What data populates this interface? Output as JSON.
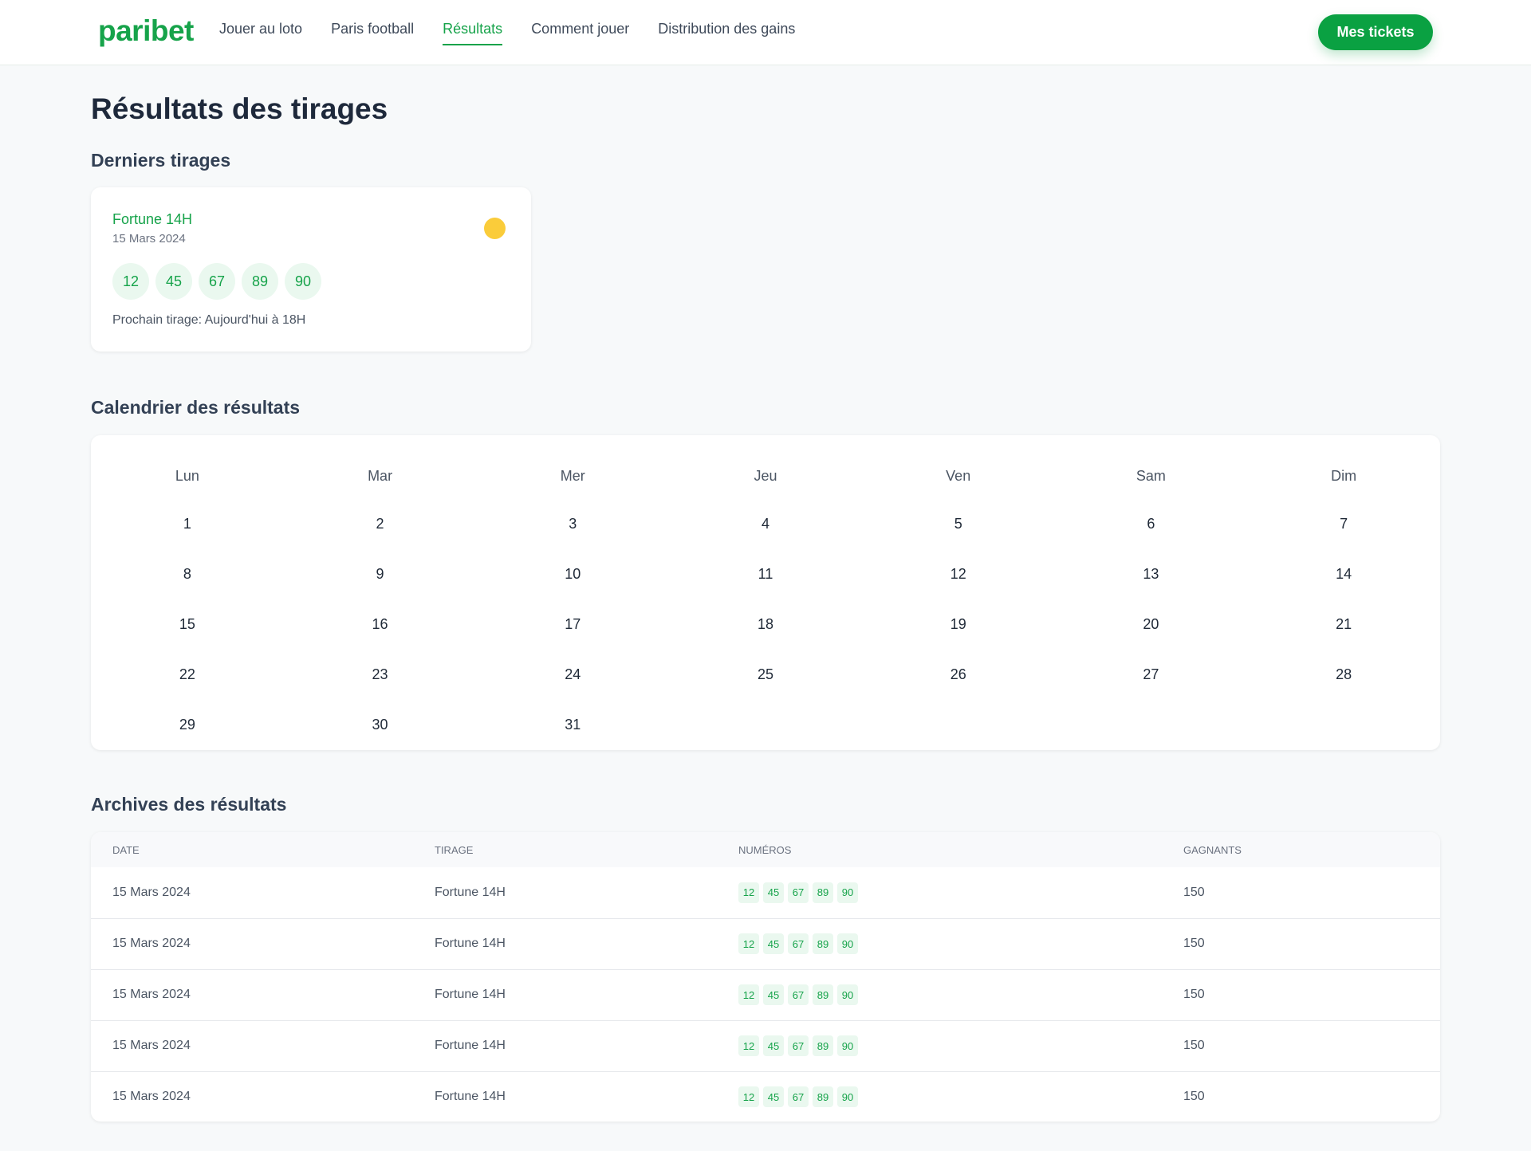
{
  "brand": {
    "logo": "paribet"
  },
  "nav": {
    "items": [
      {
        "label": "Jouer au loto",
        "active": false
      },
      {
        "label": "Paris football",
        "active": false
      },
      {
        "label": "Résultats",
        "active": true
      },
      {
        "label": "Comment jouer",
        "active": false
      },
      {
        "label": "Distribution des gains",
        "active": false
      }
    ],
    "tickets_button": "Mes tickets"
  },
  "page": {
    "title": "Résultats des tirages"
  },
  "latest": {
    "section_title": "Derniers tirages",
    "draw": {
      "name": "Fortune 14H",
      "date": "15 Mars 2024",
      "icon": "sun-icon",
      "numbers": [
        "12",
        "45",
        "67",
        "89",
        "90"
      ],
      "next_draw": "Prochain tirage: Aujourd'hui à 18H"
    }
  },
  "calendar": {
    "section_title": "Calendrier des résultats",
    "weekdays": [
      "Lun",
      "Mar",
      "Mer",
      "Jeu",
      "Ven",
      "Sam",
      "Dim"
    ],
    "days": [
      "1",
      "2",
      "3",
      "4",
      "5",
      "6",
      "7",
      "8",
      "9",
      "10",
      "11",
      "12",
      "13",
      "14",
      "15",
      "16",
      "17",
      "18",
      "19",
      "20",
      "21",
      "22",
      "23",
      "24",
      "25",
      "26",
      "27",
      "28",
      "29",
      "30",
      "31"
    ]
  },
  "archives": {
    "section_title": "Archives des résultats",
    "columns": [
      "DATE",
      "TIRAGE",
      "NUMÉROS",
      "GAGNANTS"
    ],
    "rows": [
      {
        "date": "15 Mars 2024",
        "draw": "Fortune 14H",
        "numbers": [
          "12",
          "45",
          "67",
          "89",
          "90"
        ],
        "winners": "150"
      },
      {
        "date": "15 Mars 2024",
        "draw": "Fortune 14H",
        "numbers": [
          "12",
          "45",
          "67",
          "89",
          "90"
        ],
        "winners": "150"
      },
      {
        "date": "15 Mars 2024",
        "draw": "Fortune 14H",
        "numbers": [
          "12",
          "45",
          "67",
          "89",
          "90"
        ],
        "winners": "150"
      },
      {
        "date": "15 Mars 2024",
        "draw": "Fortune 14H",
        "numbers": [
          "12",
          "45",
          "67",
          "89",
          "90"
        ],
        "winners": "150"
      },
      {
        "date": "15 Mars 2024",
        "draw": "Fortune 14H",
        "numbers": [
          "12",
          "45",
          "67",
          "89",
          "90"
        ],
        "winners": "150"
      }
    ]
  },
  "colors": {
    "accent": "#16a34a",
    "button": "#0aa142",
    "sun": "#facc3a"
  }
}
